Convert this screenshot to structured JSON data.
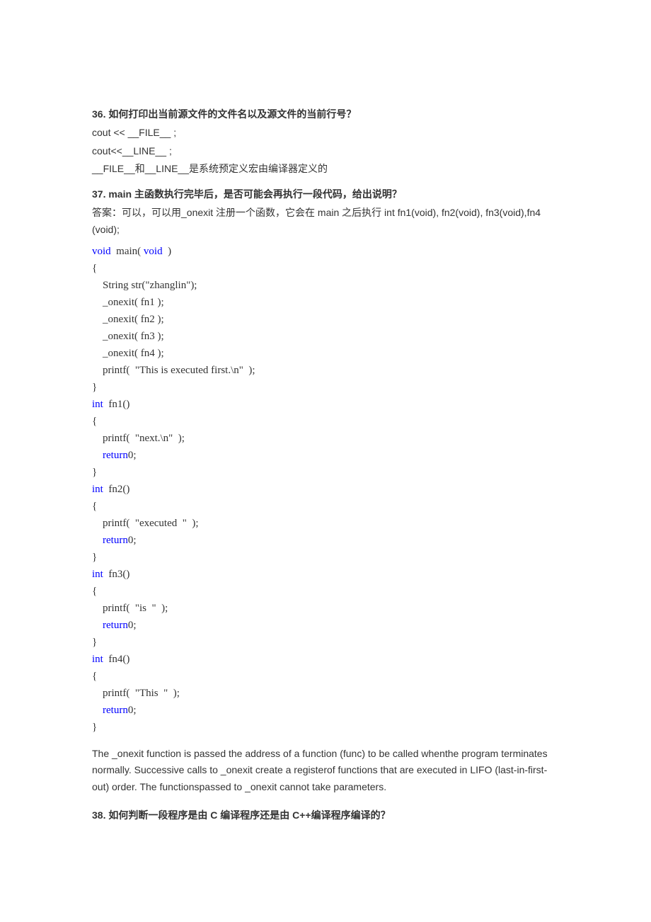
{
  "q36": {
    "heading_num": "36.",
    "heading_text": "如何打印出当前源文件的文件名以及源文件的当前行号？",
    "line1": "cout << __FILE__ ;",
    "line2": "cout<<__LINE__ ;",
    "line3": "__FILE__和__LINE__是系统预定义宏由编译器定义的"
  },
  "q37": {
    "heading_num": "37. main",
    "heading_text": "主函数执行完毕后，是否可能会再执行一段代码，给出说明？",
    "answer1": "答案：可以，可以用_onexit 注册一个函数，它会在 main  之后执行 int fn1(void), fn2(void), fn3(void),fn4 (void);"
  },
  "code": {
    "l1a": "void",
    "l1b": "  main( ",
    "l1c": "void",
    "l1d": "  )",
    "l2": "{",
    "l3": "    String str(\"zhanglin\");",
    "l4": "    _onexit( fn1 );",
    "l5": "    _onexit( fn2 );",
    "l6": "    _onexit( fn3 );",
    "l7": "    _onexit( fn4 );",
    "l8": "    printf(  \"This is executed first.\\n\"  );",
    "l9": "}",
    "l10a": "int",
    "l10b": "  fn1()",
    "l11": "{",
    "l12": "    printf(  \"next.\\n\"  );",
    "l13a": "    ",
    "l13b": "return",
    "l13c": "0;",
    "l14": "}",
    "l15a": "int",
    "l15b": "  fn2()",
    "l16": "{",
    "l17": "    printf(  \"executed  \"  );",
    "l18a": "    ",
    "l18b": "return",
    "l18c": "0;",
    "l19": "}",
    "l20a": "int",
    "l20b": "  fn3()",
    "l21": "{",
    "l22": "    printf(  \"is  \"  );",
    "l23a": "    ",
    "l23b": "return",
    "l23c": "0;",
    "l24": "}",
    "l25a": "int",
    "l25b": "  fn4()",
    "l26": "{",
    "l27": "    printf(  \"This  \"  );",
    "l28a": "    ",
    "l28b": "return",
    "l28c": "0;",
    "l29": "}"
  },
  "explain": "The _onexit function is passed the address of a function (func) to be called whenthe program terminates normally. Successive calls to _onexit create a registerof functions that are executed in LIFO (last-in-first-out) order. The functionspassed to _onexit cannot take parameters.",
  "q38": {
    "heading_num": "38.",
    "heading_text": "如何判断一段程序是由 C 编译程序还是由 C++编译程序编译的？"
  }
}
